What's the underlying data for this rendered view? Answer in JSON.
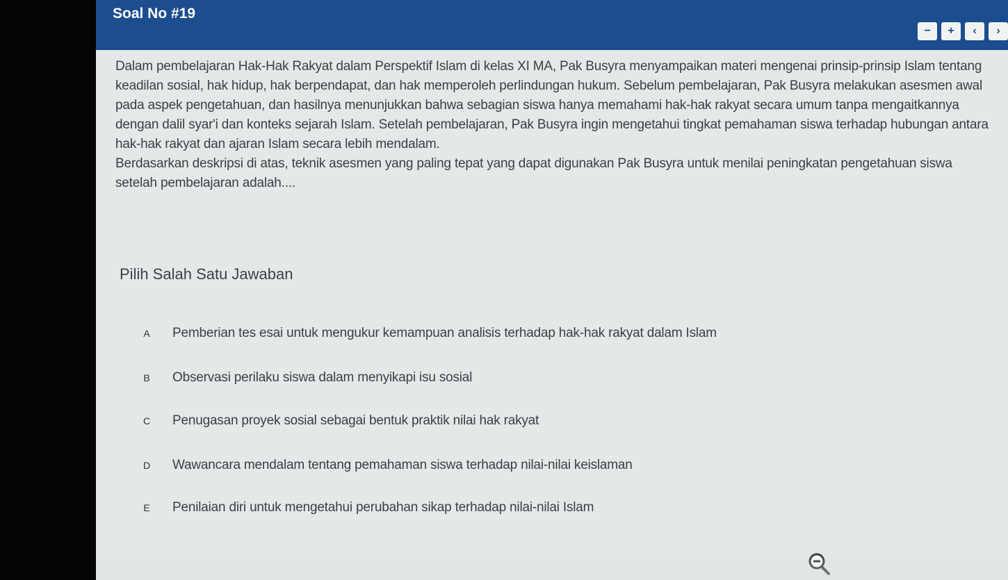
{
  "header": {
    "title": "Soal No #19",
    "buttons": [
      {
        "label": "−",
        "icon": "minus-icon"
      },
      {
        "label": "+",
        "icon": "plus-icon"
      },
      {
        "label": "‹",
        "icon": "chevron-left-icon"
      },
      {
        "label": "›",
        "icon": "chevron-right-icon"
      }
    ]
  },
  "question": {
    "paragraph1": "Dalam pembelajaran Hak-Hak Rakyat dalam Perspektif Islam di kelas XI MA, Pak Busyra menyampaikan materi mengenai prinsip-prinsip Islam tentang keadilan sosial, hak hidup, hak berpendapat, dan hak memperoleh perlindungan hukum. Sebelum pembelajaran, Pak Busyra melakukan asesmen awal pada aspek pengetahuan, dan hasilnya menunjukkan bahwa sebagian siswa hanya memahami hak-hak rakyat secara umum tanpa mengaitkannya dengan dalil syar'i dan konteks sejarah Islam. Setelah pembelajaran, Pak Busyra ingin mengetahui tingkat pemahaman siswa terhadap hubungan antara hak-hak rakyat dan ajaran Islam secara lebih mendalam.",
    "paragraph2": "Berdasarkan deskripsi di atas, teknik asesmen yang paling tepat yang dapat digunakan Pak Busyra untuk menilai peningkatan pengetahuan siswa setelah pembelajaran adalah...."
  },
  "instruction": "Pilih Salah Satu Jawaban",
  "options": [
    {
      "letter": "A",
      "text": "Pemberian tes esai untuk mengukur kemampuan analisis terhadap hak-hak rakyat dalam Islam"
    },
    {
      "letter": "B",
      "text": "Observasi perilaku siswa dalam menyikapi isu sosial"
    },
    {
      "letter": "C",
      "text": "Penugasan proyek sosial sebagai bentuk praktik nilai hak rakyat"
    },
    {
      "letter": "D",
      "text": "Wawancara mendalam tentang pemahaman siswa terhadap nilai-nilai keislaman"
    },
    {
      "letter": "E",
      "text": "Penilaian diri untuk mengetahui perubahan sikap terhadap nilai-nilai Islam"
    }
  ],
  "colors": {
    "header_bg": "#1b4d8f",
    "page_bg": "#e3e8e8",
    "text": "#3b3f42"
  },
  "cursor": {
    "icon": "zoom-out-cursor-icon"
  }
}
